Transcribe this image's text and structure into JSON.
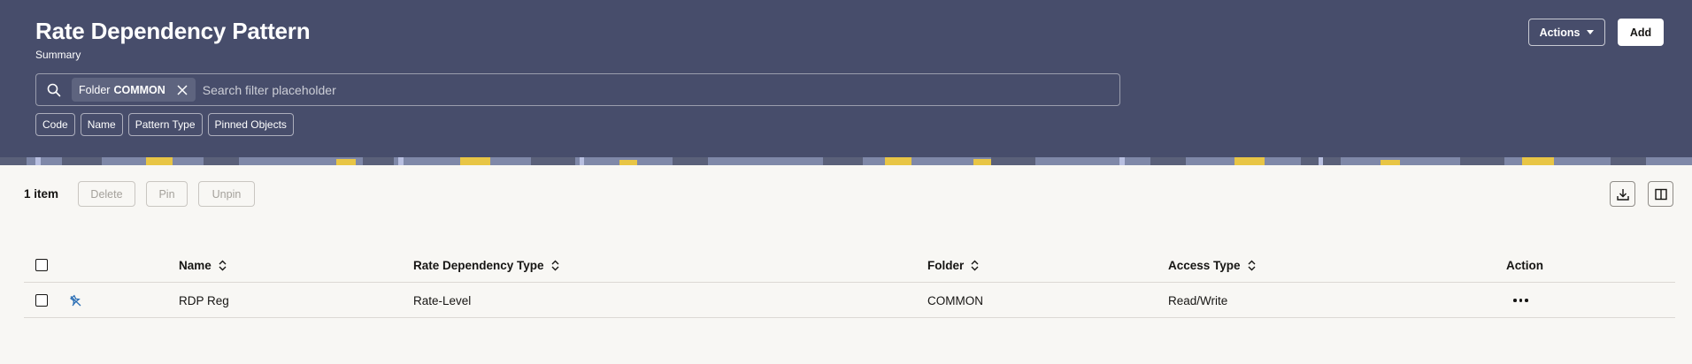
{
  "header": {
    "title": "Rate Dependency Pattern",
    "subtitle": "Summary",
    "actions_label": "Actions",
    "add_label": "Add",
    "background_color": "#474d6b"
  },
  "search": {
    "icon": "search-icon",
    "chip": {
      "key": "Folder",
      "value": "COMMON",
      "close_icon": "close-icon"
    },
    "placeholder": "Search filter placeholder"
  },
  "quick_filters": [
    "Code",
    "Name",
    "Pattern Type",
    "Pinned Objects"
  ],
  "toolbar": {
    "item_count": "1 item",
    "delete_label": "Delete",
    "pin_label": "Pin",
    "unpin_label": "Unpin",
    "download_icon": "download-icon",
    "columns_icon": "column-layout-icon"
  },
  "table": {
    "columns": [
      "Name",
      "Rate Dependency Type",
      "Folder",
      "Access Type",
      "Action"
    ],
    "rows": [
      {
        "pin_icon": "unpin-icon",
        "name": "RDP Reg",
        "rate_dependency_type": "Rate-Level",
        "folder": "COMMON",
        "access_type": "Read/Write",
        "action_icon": "more-options-icon"
      }
    ]
  }
}
